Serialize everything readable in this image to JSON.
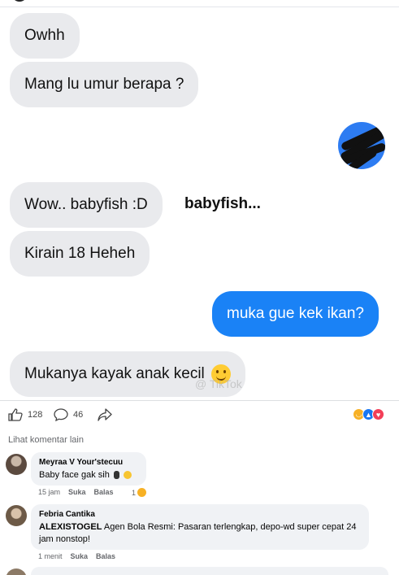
{
  "chat": {
    "messages": [
      {
        "text": "Owhh",
        "side": "in"
      },
      {
        "text": "Mang lu umur berapa ?",
        "side": "in"
      },
      {
        "text": "Wow.. babyfish :D",
        "side": "in"
      },
      {
        "text": "Kirain 18 Heheh",
        "side": "in"
      },
      {
        "text": "muka gue kek ikan?",
        "side": "out"
      },
      {
        "text": "Mukanya kayak anak kecil",
        "side": "in",
        "emoji": "smile-emoji"
      }
    ],
    "caption": "babyfish...",
    "watermark": "@ TikTok",
    "colors": {
      "incoming": "#e9eaed",
      "outgoing": "#1a82f6"
    }
  },
  "post_actions": {
    "like_count": "128",
    "comment_count": "46",
    "reactions": [
      "haha",
      "like",
      "love"
    ]
  },
  "comments": {
    "more_label": "Lihat komentar lain",
    "items": [
      {
        "author": "Meyraa V Your'stecuu",
        "text": "Baby face gak sih",
        "time": "15 jam",
        "like_label": "Suka",
        "reply_label": "Balas",
        "reaction_count": "1"
      },
      {
        "author": "Febria Cantika",
        "text_bold": "ALEXISTOGEL",
        "text": "Agen Bola Resmi: Pasaran terlengkap, depo-wd super cepat 24 jam nonstop!",
        "time": "1 menit",
        "like_label": "Suka",
        "reply_label": "Balas"
      }
    ]
  }
}
